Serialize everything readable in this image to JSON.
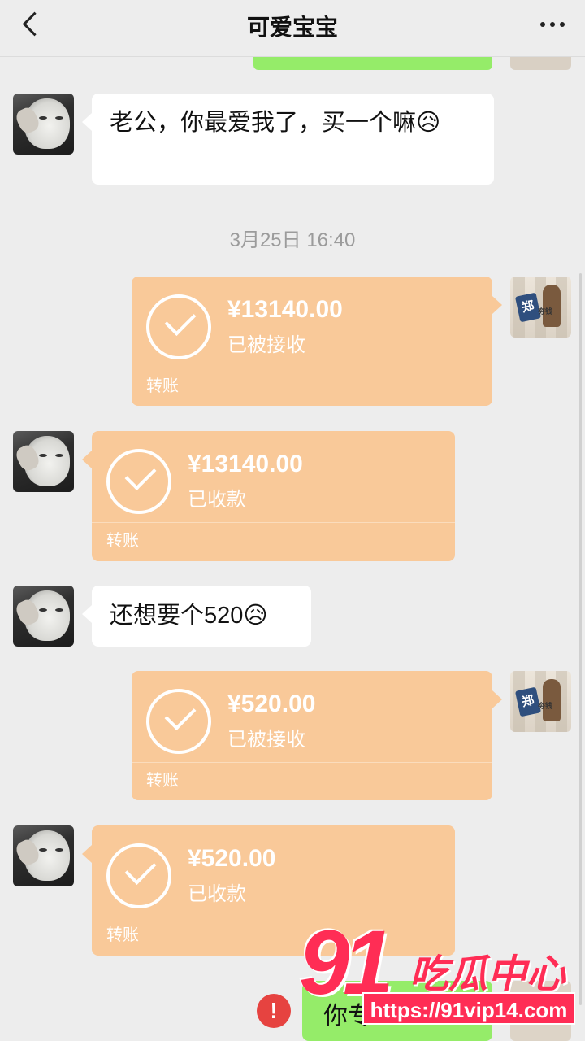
{
  "header": {
    "title": "可爱宝宝"
  },
  "messages": {
    "m1_text": "老公，你最爱我了，买一个嘛😥",
    "m1_text2": "😥",
    "timestamp": "3月25日 16:40",
    "t1": {
      "amount": "¥13140.00",
      "status": "已被接收",
      "kind": "转账"
    },
    "t2": {
      "amount": "¥13140.00",
      "status": "已收款",
      "kind": "转账"
    },
    "m2_text": "还想要个520😥",
    "t3": {
      "amount": "¥520.00",
      "status": "已被接收",
      "kind": "转账"
    },
    "t4": {
      "amount": "¥520.00",
      "status": "已收款",
      "kind": "转账"
    },
    "pending_text": "你专",
    "error_mark": "!"
  },
  "avatars": {
    "boy_badge": "郑",
    "boy_caption": "夯钱"
  },
  "watermark": {
    "logo": "91",
    "name": "吃瓜中心",
    "url": "https://91vip14.com"
  },
  "colors": {
    "transfer": "#f9c999",
    "own_bubble": "#95ec69",
    "error": "#e64340"
  }
}
